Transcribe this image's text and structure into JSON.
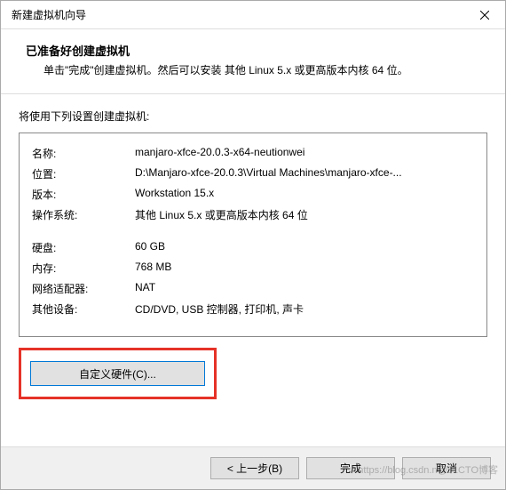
{
  "window": {
    "title": "新建虚拟机向导",
    "close_icon": "close"
  },
  "header": {
    "title": "已准备好创建虚拟机",
    "subtitle": "单击\"完成\"创建虚拟机。然后可以安装 其他 Linux 5.x 或更高版本内核 64 位。"
  },
  "content": {
    "intro": "将使用下列设置创建虚拟机:"
  },
  "settings": {
    "rows": [
      {
        "label": "名称:",
        "value": "manjaro-xfce-20.0.3-x64-neutionwei"
      },
      {
        "label": "位置:",
        "value": "D:\\Manjaro-xfce-20.0.3\\Virtual Machines\\manjaro-xfce-..."
      },
      {
        "label": "版本:",
        "value": "Workstation 15.x"
      },
      {
        "label": "操作系统:",
        "value": "其他 Linux 5.x 或更高版本内核 64 位"
      }
    ],
    "rows2": [
      {
        "label": "硬盘:",
        "value": "60 GB"
      },
      {
        "label": "内存:",
        "value": "768 MB"
      },
      {
        "label": "网络适配器:",
        "value": "NAT"
      },
      {
        "label": "其他设备:",
        "value": "CD/DVD, USB 控制器, 打印机, 声卡"
      }
    ]
  },
  "buttons": {
    "customize": "自定义硬件(C)...",
    "back": "< 上一步(B)",
    "finish": "完成",
    "cancel": "取消"
  },
  "watermark": "https://blog.csdn.n@51CTO博客"
}
